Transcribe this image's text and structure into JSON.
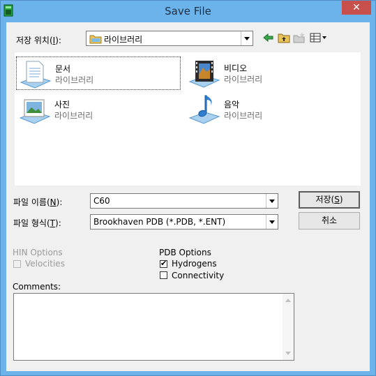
{
  "window": {
    "title": "Save File",
    "close_glyph": "✕"
  },
  "location": {
    "label_prefix": "저장 위치(",
    "label_key": "I",
    "label_suffix": "):",
    "value": "라이브러리"
  },
  "libraries": [
    {
      "name": "문서",
      "sub": "라이브러리",
      "icon": "documents-library-icon"
    },
    {
      "name": "비디오",
      "sub": "라이브러리",
      "icon": "videos-library-icon"
    },
    {
      "name": "사진",
      "sub": "라이브러리",
      "icon": "pictures-library-icon"
    },
    {
      "name": "음악",
      "sub": "라이브러리",
      "icon": "music-library-icon"
    }
  ],
  "filename": {
    "label_prefix": "파일 이름(",
    "label_key": "N",
    "label_suffix": "):",
    "value": "C60"
  },
  "filetype": {
    "label_prefix": "파일 형식(",
    "label_key": "T",
    "label_suffix": "):",
    "value": "Brookhaven PDB (*.PDB, *.ENT)"
  },
  "buttons": {
    "save_prefix": "저장(",
    "save_key": "S",
    "save_suffix": ")",
    "cancel": "취소"
  },
  "hin_options": {
    "title": "HIN Options",
    "velocities": "Velocities",
    "velocities_checked": false
  },
  "pdb_options": {
    "title": "PDB Options",
    "hydrogens": "Hydrogens",
    "hydrogens_checked": true,
    "connectivity": "Connectivity",
    "connectivity_checked": false
  },
  "comments": {
    "label": "Comments:",
    "value": ""
  },
  "colors": {
    "titlebar": "#6cb3ec",
    "close": "#c7504a",
    "dialog": "#f0f0f0"
  }
}
